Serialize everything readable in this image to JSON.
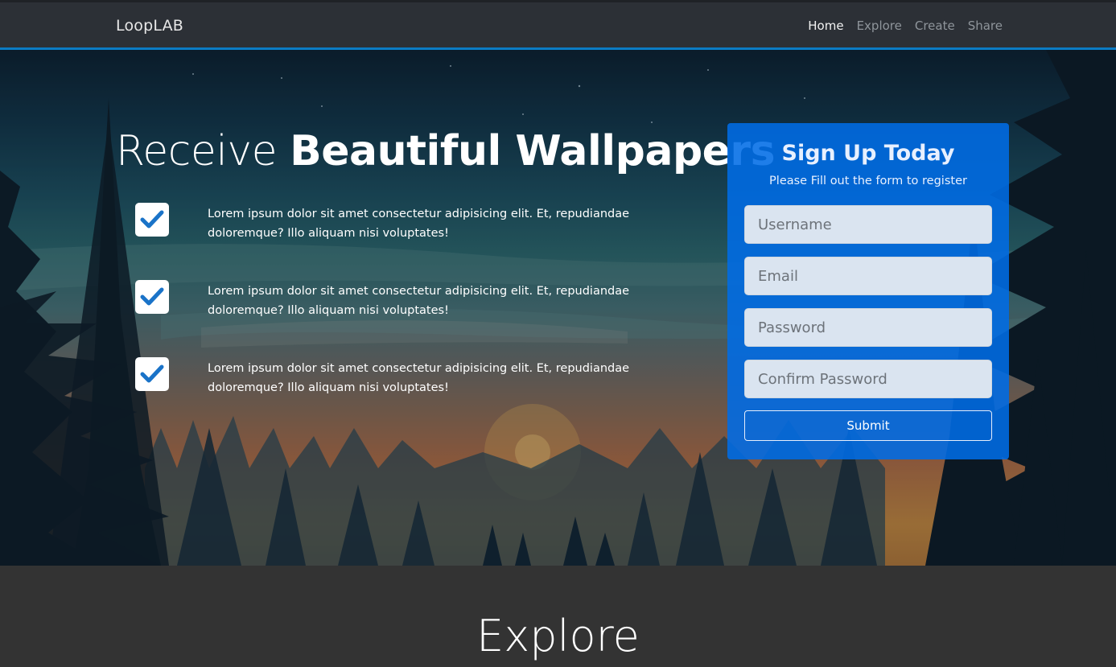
{
  "navbar": {
    "brand": "LoopLAB",
    "links": [
      "Home",
      "Explore",
      "Create",
      "Share"
    ],
    "active": "Home"
  },
  "hero": {
    "headline_light": "Receive ",
    "headline_bold": "Beautiful Wallpapers",
    "features": [
      "Lorem ipsum dolor sit amet consectetur adipisicing elit. Et, repudiandae doloremque? Illo aliquam nisi voluptates!",
      "Lorem ipsum dolor sit amet consectetur adipisicing elit. Et, repudiandae doloremque? Illo aliquam nisi voluptates!",
      "Lorem ipsum dolor sit amet consectetur adipisicing elit. Et, repudiandae doloremque? Illo aliquam nisi voluptates!"
    ],
    "check_icon": "check-icon"
  },
  "signup": {
    "title": "Sign Up Today",
    "subtitle": "Please Fill out the form to register",
    "username_placeholder": "Username",
    "email_placeholder": "Email",
    "password_placeholder": "Password",
    "confirm_placeholder": "Confirm Password",
    "submit_label": "Submit"
  },
  "explore": {
    "title": "Explore"
  },
  "colors": {
    "accent": "#0b7bc4",
    "card": "#006ce6",
    "check": "#1a73c8",
    "navbar": "#2c3036",
    "section_bg": "#333333"
  }
}
